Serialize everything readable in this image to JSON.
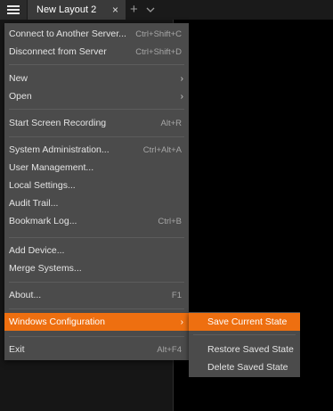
{
  "tabbar": {
    "active_tab_label": "New Layout 2",
    "close_glyph": "×",
    "add_tab_glyph": "+"
  },
  "main_menu": {
    "items": [
      {
        "label": "Connect to Another Server...",
        "shortcut": "Ctrl+Shift+C"
      },
      {
        "label": "Disconnect from Server",
        "shortcut": "Ctrl+Shift+D"
      },
      {
        "label": "New",
        "submenu_arrow": "›"
      },
      {
        "label": "Open",
        "submenu_arrow": "›"
      },
      {
        "label": "Start Screen Recording",
        "shortcut": "Alt+R"
      },
      {
        "label": "System Administration...",
        "shortcut": "Ctrl+Alt+A"
      },
      {
        "label": "User Management..."
      },
      {
        "label": "Local Settings..."
      },
      {
        "label": "Audit Trail..."
      },
      {
        "label": "Bookmark Log...",
        "shortcut": "Ctrl+B"
      },
      {
        "label": "Add Device..."
      },
      {
        "label": "Merge Systems..."
      },
      {
        "label": "About...",
        "shortcut": "F1"
      },
      {
        "label": "Windows Configuration",
        "submenu_arrow": "›",
        "highlighted": true
      },
      {
        "label": "Exit",
        "shortcut": "Alt+F4"
      }
    ]
  },
  "submenu": {
    "items": [
      {
        "label": "Save Current State",
        "highlighted": true
      },
      {
        "label": "Restore Saved State"
      },
      {
        "label": "Delete Saved State"
      }
    ]
  },
  "colors": {
    "accent": "#ee6f10",
    "menu_bg": "#4b4b4b",
    "app_bg": "#000000"
  },
  "icons": [
    "hamburger-menu-icon",
    "close-icon",
    "plus-icon",
    "chevron-down-icon",
    "submenu-arrow-icon"
  ]
}
